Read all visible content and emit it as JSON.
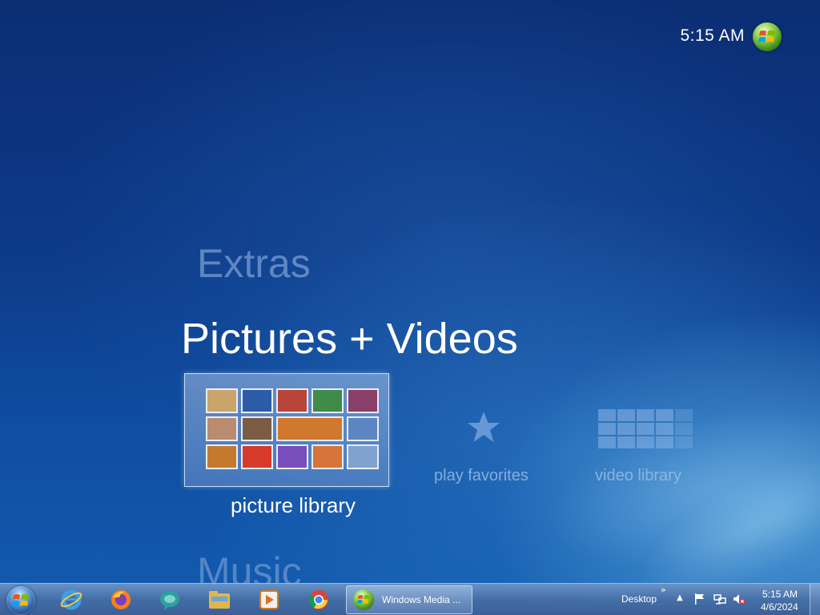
{
  "window": {
    "app": "Windows Media Center",
    "clock": "5:15 AM"
  },
  "menu": {
    "above": "Extras",
    "current": "Pictures + Videos",
    "below": "Music"
  },
  "strip": {
    "items": [
      {
        "label": "picture library",
        "icon": "picture-collage-icon",
        "focused": true
      },
      {
        "label": "play favorites",
        "icon": "star-icon",
        "focused": false
      },
      {
        "label": "video library",
        "icon": "grid-icon",
        "focused": false
      }
    ]
  },
  "thumbnail_colors": [
    "#c9a46b",
    "#2c5ca8",
    "#b8443a",
    "#3f8b4a",
    "#8a3f6a",
    "#b98c70",
    "#7b5c44",
    "#d0782d",
    "#5b86c2",
    "#c47a2e",
    "#d63a2a",
    "#7a4dbd",
    "#d6743a",
    "#7fa2cf"
  ],
  "taskbar": {
    "start_icon": "windows-start-icon",
    "pinned": [
      {
        "name": "internet-explorer",
        "icon": "ie-icon"
      },
      {
        "name": "firefox",
        "icon": "firefox-icon"
      },
      {
        "name": "messenger",
        "icon": "chat-bubble-icon"
      },
      {
        "name": "file-explorer",
        "icon": "folder-icon"
      },
      {
        "name": "media-player",
        "icon": "media-player-icon"
      },
      {
        "name": "chrome",
        "icon": "chrome-icon"
      }
    ],
    "task_label": "Windows Media ...",
    "toolbar_label": "Desktop",
    "toolbar_chevron": "»",
    "tray_expand": "▲",
    "time": "5:15 AM",
    "date": "4/6/2024"
  }
}
